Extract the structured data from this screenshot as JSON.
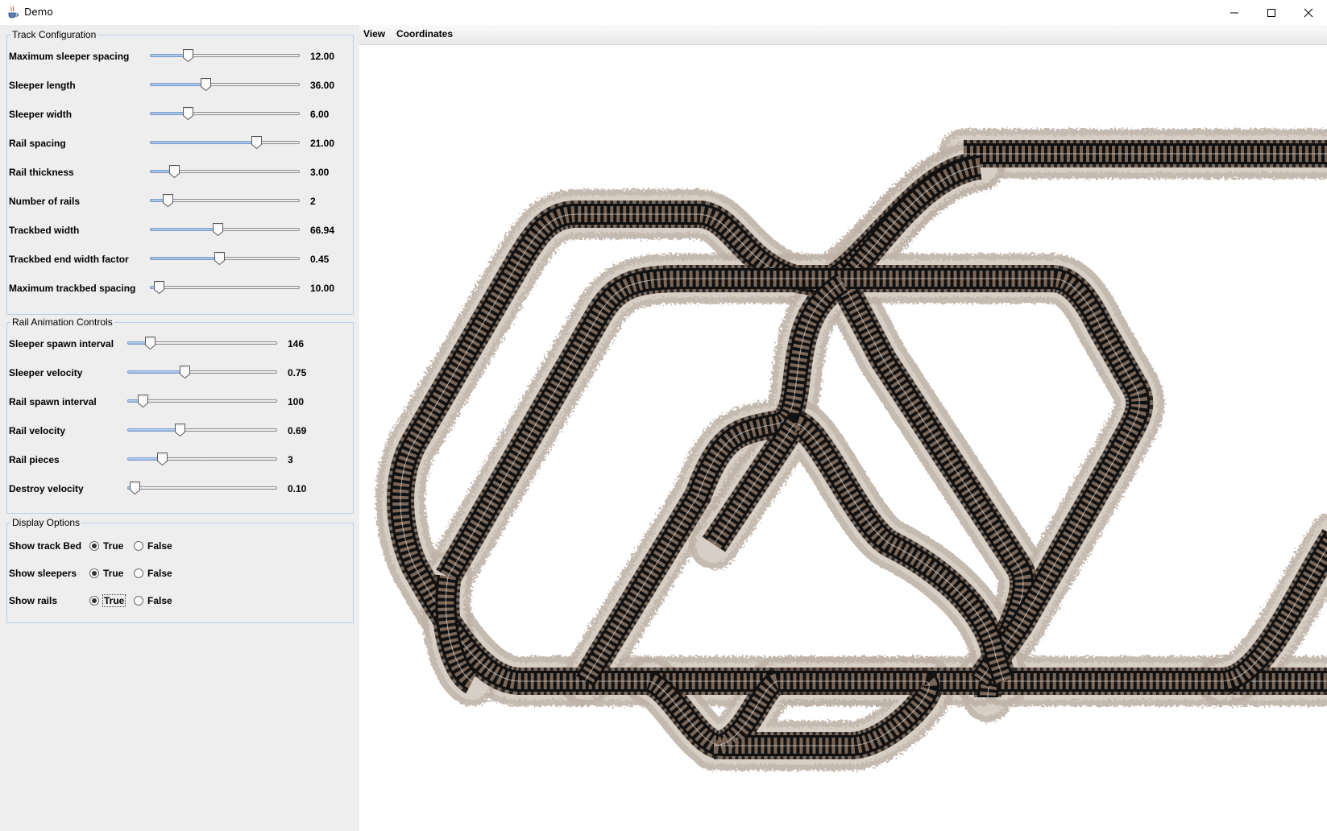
{
  "window": {
    "title": "Demo",
    "icon": "java-cup-icon"
  },
  "menubar": {
    "items": [
      "View",
      "Coordinates"
    ]
  },
  "track_config": {
    "title": "Track Configuration",
    "rows": [
      {
        "label": "Maximum sleeper spacing",
        "value": "12.00",
        "pos": 0.25
      },
      {
        "label": "Sleeper length",
        "value": "36.00",
        "pos": 0.37
      },
      {
        "label": "Sleeper width",
        "value": "6.00",
        "pos": 0.25
      },
      {
        "label": "Rail spacing",
        "value": "21.00",
        "pos": 0.71
      },
      {
        "label": "Rail thickness",
        "value": "3.00",
        "pos": 0.16
      },
      {
        "label": "Number of rails",
        "value": "2",
        "pos": 0.12
      },
      {
        "label": "Trackbed width",
        "value": "66.94",
        "pos": 0.45
      },
      {
        "label": "Trackbed end width factor",
        "value": "0.45",
        "pos": 0.46
      },
      {
        "label": "Maximum trackbed spacing",
        "value": "10.00",
        "pos": 0.06
      }
    ]
  },
  "rail_animation": {
    "title": "Rail Animation Controls",
    "rows": [
      {
        "label": "Sleeper spawn interval",
        "value": "146",
        "pos": 0.15
      },
      {
        "label": "Sleeper velocity",
        "value": "0.75",
        "pos": 0.38
      },
      {
        "label": "Rail spawn interval",
        "value": "100",
        "pos": 0.1
      },
      {
        "label": "Rail velocity",
        "value": "0.69",
        "pos": 0.35
      },
      {
        "label": "Rail pieces",
        "value": "3",
        "pos": 0.23
      },
      {
        "label": "Destroy velocity",
        "value": "0.10",
        "pos": 0.05
      }
    ]
  },
  "display_options": {
    "title": "Display Options",
    "rows": [
      {
        "label": "Show track Bed",
        "true_label": "True",
        "false_label": "False",
        "selected": "True"
      },
      {
        "label": "Show sleepers",
        "true_label": "True",
        "false_label": "False",
        "selected": "True"
      },
      {
        "label": "Show rails",
        "true_label": "True",
        "false_label": "False",
        "selected": "True"
      }
    ]
  }
}
